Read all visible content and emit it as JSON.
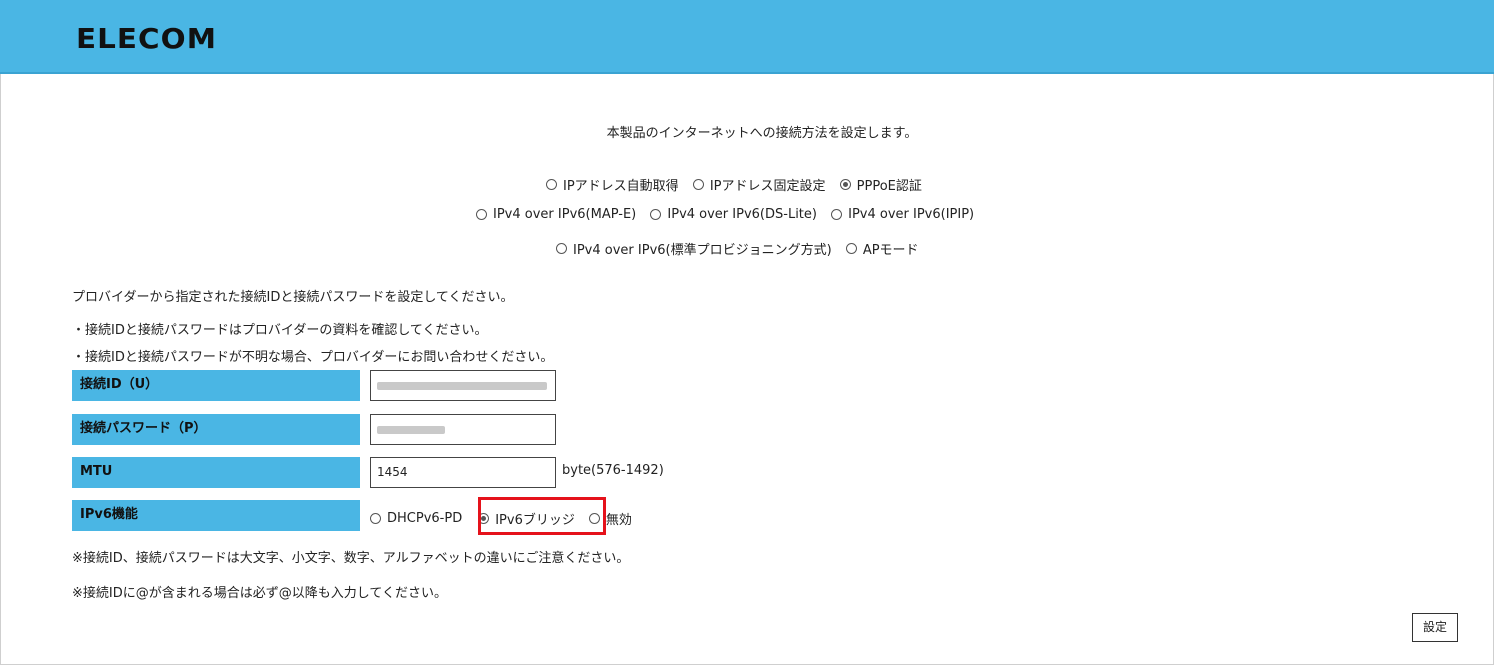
{
  "brand": {
    "logo": "ELECOM",
    "header_color": "#4ab6e4"
  },
  "intro": "本製品のインターネットへの接続方法を設定します。",
  "connection_modes": {
    "row1": [
      {
        "label": "IPアドレス自動取得",
        "checked": false
      },
      {
        "label": "IPアドレス固定設定",
        "checked": false
      },
      {
        "label": "PPPoE認証",
        "checked": true
      }
    ],
    "row2": [
      {
        "label": "IPv4 over IPv6(MAP-E)",
        "checked": false
      },
      {
        "label": "IPv4 over IPv6(DS-Lite)",
        "checked": false
      },
      {
        "label": "IPv4 over IPv6(IPIP)",
        "checked": false
      }
    ],
    "row3": [
      {
        "label": "IPv4 over IPv6(標準プロビジョニング方式)",
        "checked": false
      },
      {
        "label": "APモード",
        "checked": false
      }
    ]
  },
  "instructions": {
    "main": "プロバイダーから指定された接続IDと接続パスワードを設定してください。",
    "note1": "・接続IDと接続パスワードはプロバイダーの資料を確認してください。",
    "note2": "・接続IDと接続パスワードが不明な場合、プロバイダーにお問い合わせください。"
  },
  "form": {
    "connection_id_label": "接続ID（U）",
    "password_label": "接続パスワード（P）",
    "mtu_label": "MTU",
    "mtu_value": "1454",
    "mtu_unit": "byte(576-1492)",
    "ipv6_label": "IPv6機能",
    "ipv6_options": [
      {
        "label": "DHCPv6-PD",
        "checked": false
      },
      {
        "label": "IPv6ブリッジ",
        "checked": true
      },
      {
        "label": "無効",
        "checked": false
      }
    ]
  },
  "footnotes": {
    "case_note": "※接続ID、接続パスワードは大文字、小文字、数字、アルファベットの違いにご注意ください。",
    "at_note": "※接続IDに@が含まれる場合は必ず@以降も入力してください。"
  },
  "set_button": "設定",
  "highlight_color": "#e5121b"
}
